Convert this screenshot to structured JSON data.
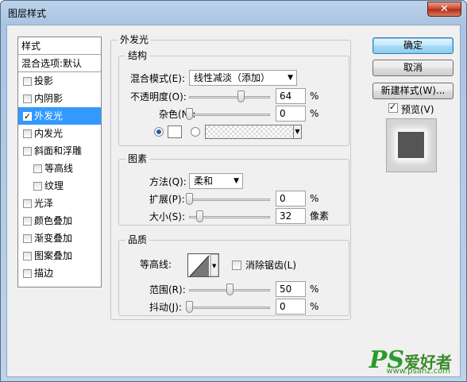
{
  "window": {
    "title": "图层样式",
    "close_label": "✕"
  },
  "style_list": {
    "header": "样式",
    "blend_default": "混合选项:默认",
    "items": [
      {
        "label": "投影",
        "checked": false,
        "sub": false,
        "selected": false
      },
      {
        "label": "内阴影",
        "checked": false,
        "sub": false,
        "selected": false
      },
      {
        "label": "外发光",
        "checked": true,
        "sub": false,
        "selected": true
      },
      {
        "label": "内发光",
        "checked": false,
        "sub": false,
        "selected": false
      },
      {
        "label": "斜面和浮雕",
        "checked": false,
        "sub": false,
        "selected": false
      },
      {
        "label": "等高线",
        "checked": false,
        "sub": true,
        "selected": false
      },
      {
        "label": "纹理",
        "checked": false,
        "sub": true,
        "selected": false
      },
      {
        "label": "光泽",
        "checked": false,
        "sub": false,
        "selected": false
      },
      {
        "label": "颜色叠加",
        "checked": false,
        "sub": false,
        "selected": false
      },
      {
        "label": "渐变叠加",
        "checked": false,
        "sub": false,
        "selected": false
      },
      {
        "label": "图案叠加",
        "checked": false,
        "sub": false,
        "selected": false
      },
      {
        "label": "描边",
        "checked": false,
        "sub": false,
        "selected": false
      }
    ]
  },
  "panel": {
    "title": "外发光",
    "structure": {
      "title": "结构",
      "blend_mode_label": "混合模式(E):",
      "blend_mode_value": "线性减淡（添加）",
      "opacity_label": "不透明度(O):",
      "opacity_value": "64",
      "opacity_level": 64,
      "noise_label": "杂色(N):",
      "noise_value": "0",
      "noise_level": 0,
      "percent": "%"
    },
    "elements": {
      "title": "图素",
      "technique_label": "方法(Q):",
      "technique_value": "柔和",
      "spread_label": "扩展(P):",
      "spread_value": "0",
      "spread_level": 0,
      "size_label": "大小(S):",
      "size_value": "32",
      "size_level": 13,
      "size_unit": "像素",
      "percent": "%"
    },
    "quality": {
      "title": "品质",
      "contour_label": "等高线:",
      "antialias_label": "消除锯齿(L)",
      "range_label": "范围(R):",
      "range_value": "50",
      "range_level": 50,
      "jitter_label": "抖动(J):",
      "jitter_value": "0",
      "jitter_level": 0,
      "percent": "%"
    }
  },
  "buttons": {
    "ok": "确定",
    "cancel": "取消",
    "new_style": "新建样式(W)...",
    "preview_label": "预览(V)"
  },
  "watermark": {
    "ps": "PS",
    "cn": "爱好者",
    "url": "www.psahz.com"
  }
}
